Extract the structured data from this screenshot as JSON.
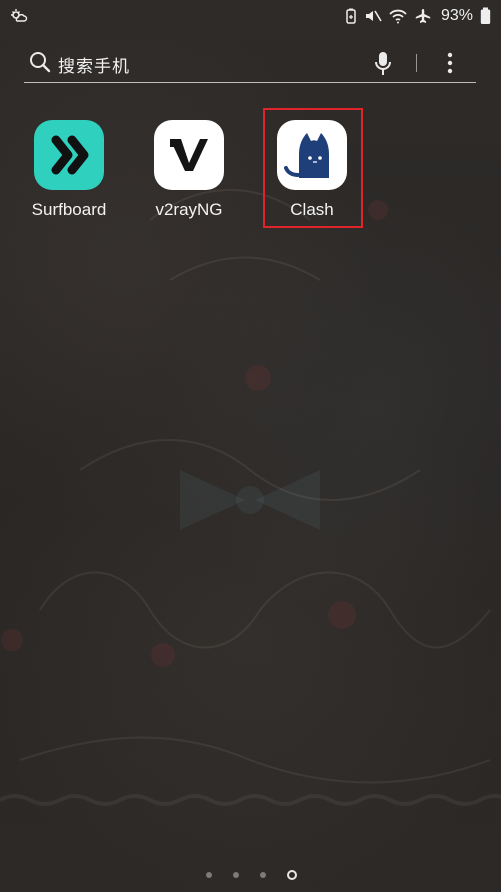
{
  "status_bar": {
    "battery_percent": "93%"
  },
  "search": {
    "placeholder": "搜索手机"
  },
  "apps": [
    {
      "label": "Surfboard",
      "icon": "surfboard-icon"
    },
    {
      "label": "v2rayNG",
      "icon": "v2rayng-icon"
    },
    {
      "label": "Clash",
      "icon": "clash-cat-icon"
    }
  ],
  "page_indicator": {
    "count": 4,
    "active_index": 3
  },
  "colors": {
    "surfboard": "#2fd0bd",
    "highlight": "#e1242c",
    "clash_cat": "#1f3f7a"
  }
}
